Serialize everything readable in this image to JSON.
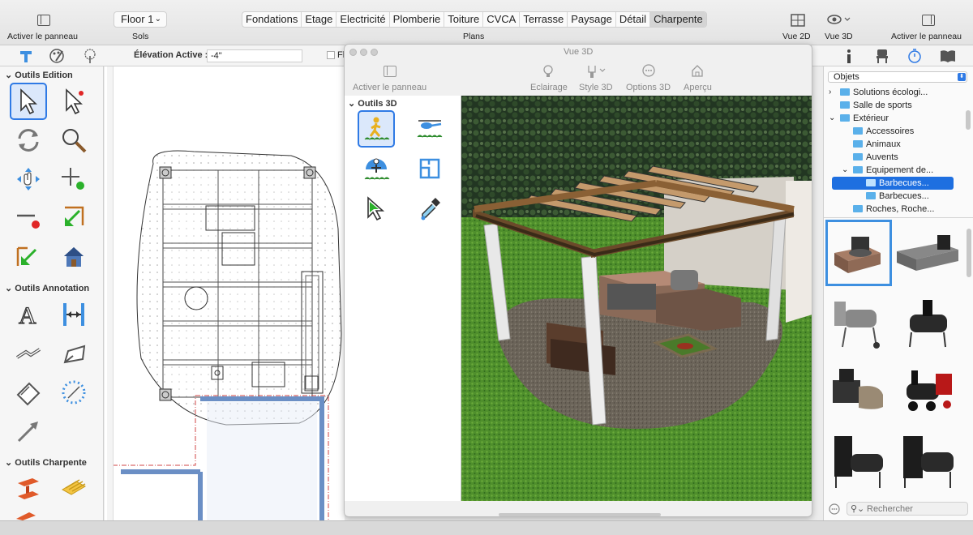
{
  "toolbar": {
    "left_panel_label": "Activer le panneau",
    "floor_selector": "Floor 1",
    "floors_label": "Sols",
    "plans_label": "Plans",
    "plan_tabs": [
      "Fondations",
      "Etage",
      "Electricité",
      "Plomberie",
      "Toiture",
      "CVCA",
      "Terrasse",
      "Paysage",
      "Détail",
      "Charpente"
    ],
    "active_tab": "Charpente",
    "view2d_label": "Vue 2D",
    "view3d_label": "Vue 3D",
    "right_panel_label": "Activer le panneau"
  },
  "elevation": {
    "label": "Élévation Active :",
    "value": "-4\"",
    "checkbox_label": "Fl"
  },
  "left_palette": {
    "edit_section": "Outils Edition",
    "annotation_section": "Outils Annotation",
    "framing_section": "Outils Charpente"
  },
  "window3d": {
    "title": "Vue 3D",
    "panel_label": "Activer le panneau",
    "lighting_label": "Eclairage",
    "style_label": "Style 3D",
    "options_label": "Options 3D",
    "preview_label": "Aperçu",
    "tools_section": "Outils 3D"
  },
  "library": {
    "dropdown": "Objets",
    "tree": [
      {
        "label": "Solutions écologi...",
        "level": 1,
        "expanded": false
      },
      {
        "label": "Salle de sports",
        "level": 1,
        "expanded": null
      },
      {
        "label": "Extérieur",
        "level": 1,
        "expanded": true
      },
      {
        "label": "Accessoires",
        "level": 2,
        "expanded": null
      },
      {
        "label": "Animaux",
        "level": 2,
        "expanded": null
      },
      {
        "label": "Auvents",
        "level": 2,
        "expanded": null
      },
      {
        "label": "Equipement de...",
        "level": 2,
        "expanded": true
      },
      {
        "label": "Barbecues...",
        "level": 3,
        "expanded": null,
        "selected": true
      },
      {
        "label": "Barbecues...",
        "level": 3,
        "expanded": null
      },
      {
        "label": "Roches, Roche...",
        "level": 2,
        "expanded": null
      }
    ],
    "search_placeholder": "Rechercher"
  },
  "colors": {
    "accent": "#2f7ae5",
    "selection_bg": "#1e6fe0",
    "folder": "#5ab0ea",
    "grass": "#4f8f2c"
  }
}
